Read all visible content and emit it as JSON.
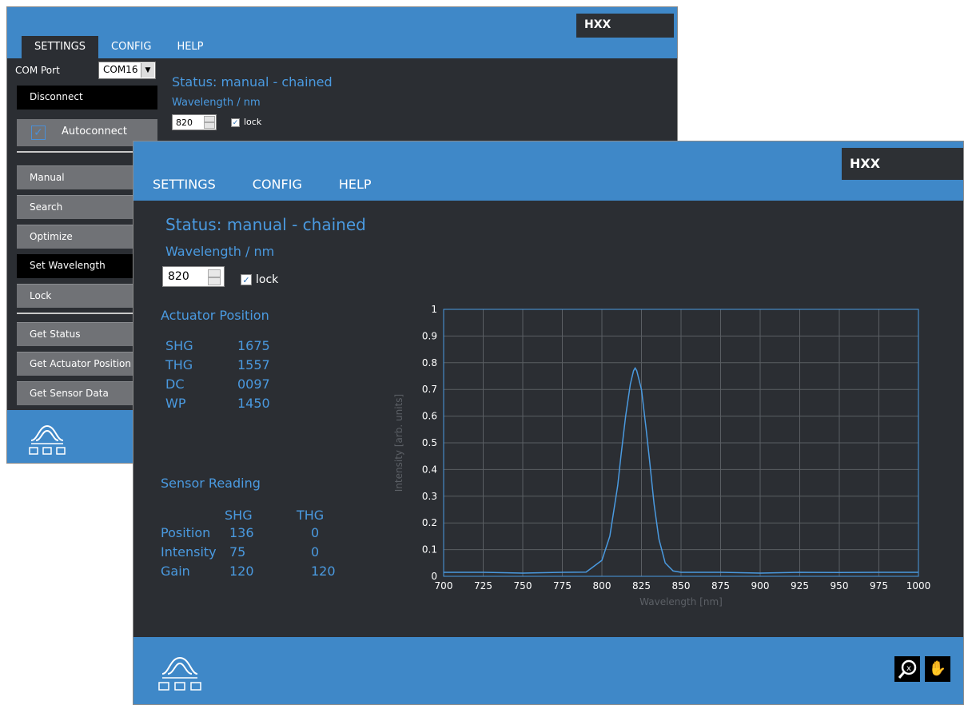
{
  "back_window": {
    "brand": "HXX",
    "menu": [
      "SETTINGS",
      "CONFIG",
      "HELP"
    ],
    "com_port_label": "COM Port",
    "com_port_value": "COM16",
    "disconnect_label": "Disconnect",
    "autoconnect_label": "Autoconnect",
    "autoconnect_checked": true,
    "buttons": [
      "Manual",
      "Search",
      "Optimize",
      "Set Wavelength",
      "Lock",
      "Get Status",
      "Get Actuator Position",
      "Get Sensor Data"
    ],
    "status": "Status:  manual - chained",
    "wavelength_label": "Wavelength / nm",
    "wavelength_value": "820",
    "lock_label": "lock"
  },
  "front_window": {
    "brand": "HXX",
    "menu": [
      "SETTINGS",
      "CONFIG",
      "HELP"
    ],
    "status": "Status:  manual - chained",
    "wavelength_label": "Wavelength / nm",
    "wavelength_value": "820",
    "lock_label": "lock",
    "lock_checked": true,
    "actuator": {
      "title": "Actuator Position",
      "rows": [
        {
          "name": "SHG",
          "value": "1675"
        },
        {
          "name": "THG",
          "value": "1557"
        },
        {
          "name": "DC",
          "value": "0097"
        },
        {
          "name": "WP",
          "value": "1450"
        }
      ]
    },
    "sensor": {
      "title": "Sensor Reading",
      "cols": [
        "SHG",
        "THG"
      ],
      "rows": [
        {
          "name": "Position",
          "shg": "136",
          "thg": "0"
        },
        {
          "name": "Intensity",
          "shg": "75",
          "thg": "0"
        },
        {
          "name": "Gain",
          "shg": "120",
          "thg": "120"
        }
      ]
    },
    "tools": [
      "zoom-reset-icon",
      "pan-hand-icon"
    ]
  },
  "chart_data": {
    "type": "line",
    "xlabel": "Wavelength [nm]",
    "ylabel": "Intensity [arb. units]",
    "xlim": [
      700,
      1000
    ],
    "ylim": [
      0,
      1
    ],
    "xticks": [
      700,
      725,
      750,
      775,
      800,
      825,
      850,
      875,
      900,
      925,
      950,
      975,
      1000
    ],
    "yticks": [
      0,
      0.1,
      0.2,
      0.3,
      0.4,
      0.5,
      0.6,
      0.7,
      0.8,
      0.9,
      1
    ],
    "grid": true,
    "line_color": "#4a9ae0",
    "series": [
      {
        "x": [
          700,
          725,
          750,
          775,
          790,
          800,
          805,
          810,
          812,
          815,
          818,
          820,
          821,
          822,
          825,
          828,
          830,
          833,
          836,
          840,
          845,
          850,
          875,
          900,
          925,
          950,
          975,
          1000
        ],
        "values": [
          0.015,
          0.015,
          0.012,
          0.015,
          0.016,
          0.06,
          0.15,
          0.34,
          0.45,
          0.6,
          0.72,
          0.77,
          0.78,
          0.77,
          0.7,
          0.55,
          0.44,
          0.27,
          0.14,
          0.05,
          0.02,
          0.015,
          0.015,
          0.012,
          0.015,
          0.014,
          0.015,
          0.015
        ]
      }
    ]
  }
}
